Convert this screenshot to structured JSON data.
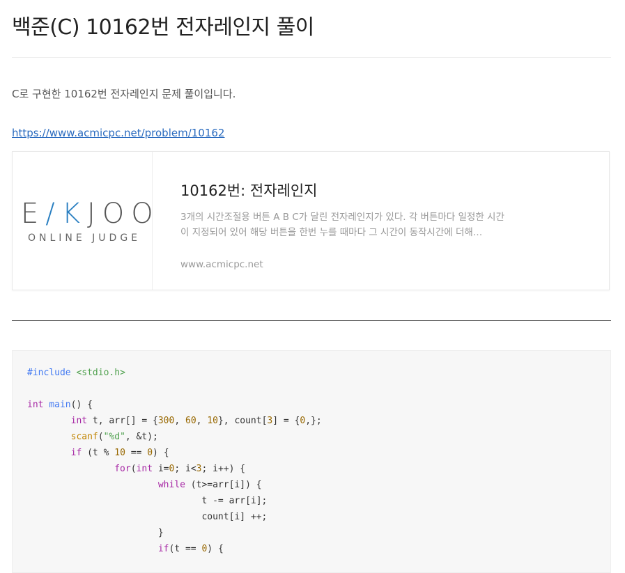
{
  "post": {
    "title": "백준(C) 10162번 전자레인지 풀이",
    "intro": "C로 구현한 10162번 전자레인지 문제 풀이입니다.",
    "link_text": "https://www.acmicpc.net/problem/10162"
  },
  "card": {
    "logo_main_left": "E",
    "logo_main_k": "/K",
    "logo_main_right": "JOO",
    "logo_sub": "ONLINE JUDGE",
    "title": "10162번: 전자레인지",
    "description": "3개의 시간조절용 버튼 A B C가 달린 전자레인지가 있다. 각 버튼마다 일정한 시간이 지정되어 있어 해당 버튼을 한번 누를 때마다 그 시간이 동작시간에 더해…",
    "domain": "www.acmicpc.net"
  },
  "code": {
    "lines": [
      "#include <stdio.h>",
      "",
      "int main() {",
      "        int t, arr[] = {300, 60, 10}, count[3] = {0,};",
      "        scanf(\"%d\", &t);",
      "        if (t % 10 == 0) {",
      "                for(int i=0; i<3; i++) {",
      "                        while (t>=arr[i]) {",
      "                                t -= arr[i];",
      "                                count[i] ++;",
      "                        }",
      "                        if(t == 0) {"
    ]
  },
  "colors": {
    "link": "#2a6bbf",
    "logo_accent": "#2a7fc1",
    "code_background": "#f7f7f7"
  }
}
